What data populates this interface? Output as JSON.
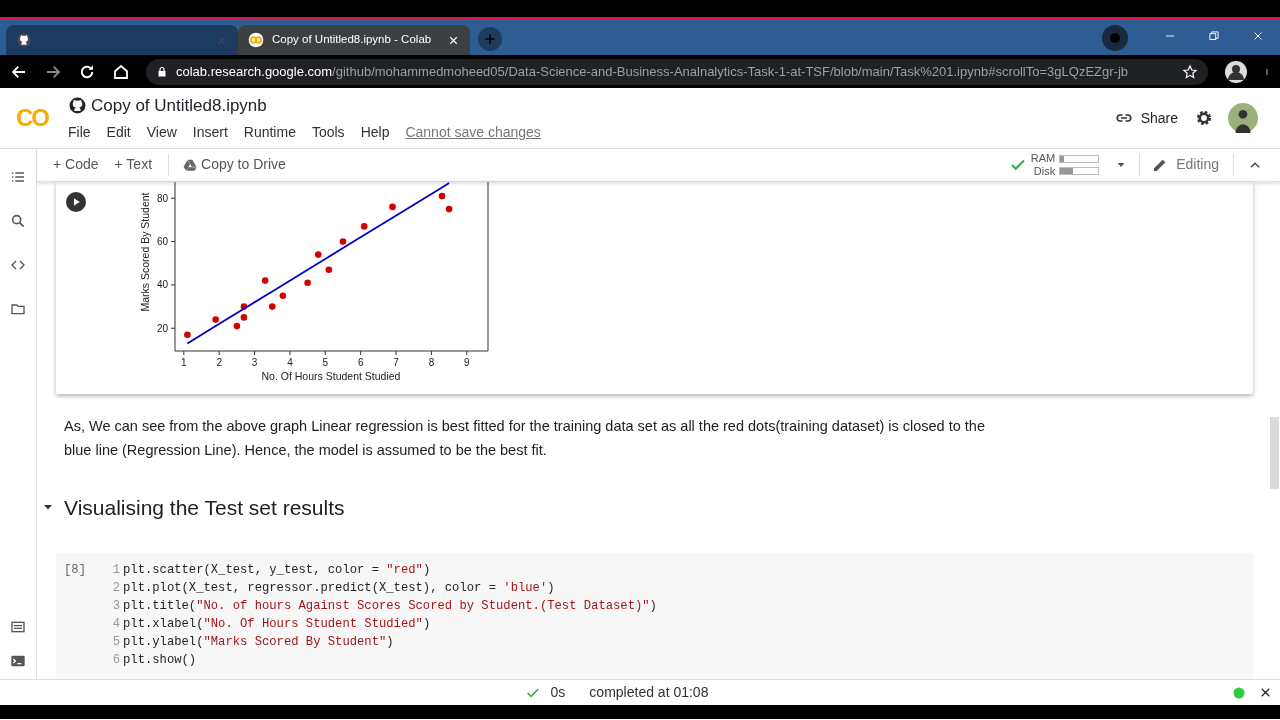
{
  "browser": {
    "tabs": [
      {
        "selected": false
      },
      {
        "title": "Copy of Untitled8.ipynb - Colab",
        "selected": true
      }
    ],
    "url_host": "colab.research.google.com",
    "url_path": "/github/mohammedmoheed05/Data-Science-and-Business-Analnalytics-Task-1-at-TSF/blob/main/Task%201.ipynb#scrollTo=3gLQzEZgr-jb"
  },
  "header": {
    "logo": "CO",
    "title": "Copy of Untitled8.ipynb",
    "menu": [
      "File",
      "Edit",
      "View",
      "Insert",
      "Runtime",
      "Tools",
      "Help"
    ],
    "notice": "Cannot save changes",
    "share": "Share"
  },
  "toolbar": {
    "buttons": [
      "+ Code",
      "+ Text"
    ],
    "copy": "Copy to Drive",
    "meters": [
      {
        "label": "RAM",
        "level": 0.1
      },
      {
        "label": "Disk",
        "level": 0.35
      }
    ],
    "mode": "Editing"
  },
  "output_chart": {
    "chart_data": {
      "type": "scatter",
      "xlabel": "No. Of Hours Student Studied",
      "ylabel": "Marks Scored By Student",
      "x": [
        1.1,
        1.9,
        2.5,
        2.7,
        2.7,
        3.3,
        3.5,
        3.8,
        4.5,
        4.8,
        5.1,
        5.5,
        6.1,
        6.9,
        8.3,
        8.5
      ],
      "xlim": [
        0.75,
        9.6
      ],
      "ylim": [
        9.5,
        87.5
      ],
      "xticks": [
        1,
        2,
        3,
        4,
        5,
        6,
        7,
        8,
        9
      ],
      "yticks": [
        20,
        40,
        60,
        80
      ],
      "series": [
        {
          "color": "#d40000",
          "values": [
            17,
            24,
            21,
            30,
            25,
            42,
            30,
            35,
            41,
            54,
            47,
            60,
            67,
            76,
            81,
            75
          ]
        },
        {
          "type": "line",
          "color": "#0000c8",
          "values": [
            13,
            21,
            27,
            29,
            29,
            35,
            37,
            40,
            47,
            50,
            53,
            57,
            63,
            71,
            85,
            87
          ]
        }
      ]
    }
  },
  "text_cell": "As, We can see from the above graph Linear regression is best fitted for the training data set as all the red dots(training dataset) is closed to the blue line (Regression Line). Hence, the model is assumed to be the best fit.",
  "section": {
    "title": "Visualising the Test set results",
    "expanded": true
  },
  "code_cell": {
    "count": "[8]",
    "lines": [
      [
        {
          "t": "plt.scatter(X_test, y_test, color = ",
          "kind": "plain"
        },
        {
          "t": "\"red\"",
          "kind": "string"
        },
        {
          "t": ")",
          "kind": "plain"
        }
      ],
      [
        {
          "t": "plt.plot(X_test, regressor.predict(X_test), color = ",
          "kind": "plain"
        },
        {
          "t": "'blue'",
          "kind": "string"
        },
        {
          "t": ")",
          "kind": "plain"
        }
      ],
      [
        {
          "t": "plt.title(",
          "kind": "plain"
        },
        {
          "t": "\"No. of hours Against Scores Scored by Student.(Test Dataset)\"",
          "kind": "string"
        },
        {
          "t": ")",
          "kind": "plain"
        }
      ],
      [
        {
          "t": "plt.xlabel(",
          "kind": "plain"
        },
        {
          "t": "\"No. Of Hours Student Studied\"",
          "kind": "string"
        },
        {
          "t": ")",
          "kind": "plain"
        }
      ],
      [
        {
          "t": "plt.ylabel(",
          "kind": "plain"
        },
        {
          "t": "\"Marks Scored By Student\"",
          "kind": "string"
        },
        {
          "t": ")",
          "kind": "plain"
        }
      ],
      [
        {
          "t": "plt.show()",
          "kind": "plain"
        }
      ]
    ],
    "line_numbers": [
      "1",
      "2",
      "3",
      "4",
      "5",
      "6"
    ]
  },
  "status_bar": {
    "duration": "0s",
    "message": "completed at 01:08"
  }
}
